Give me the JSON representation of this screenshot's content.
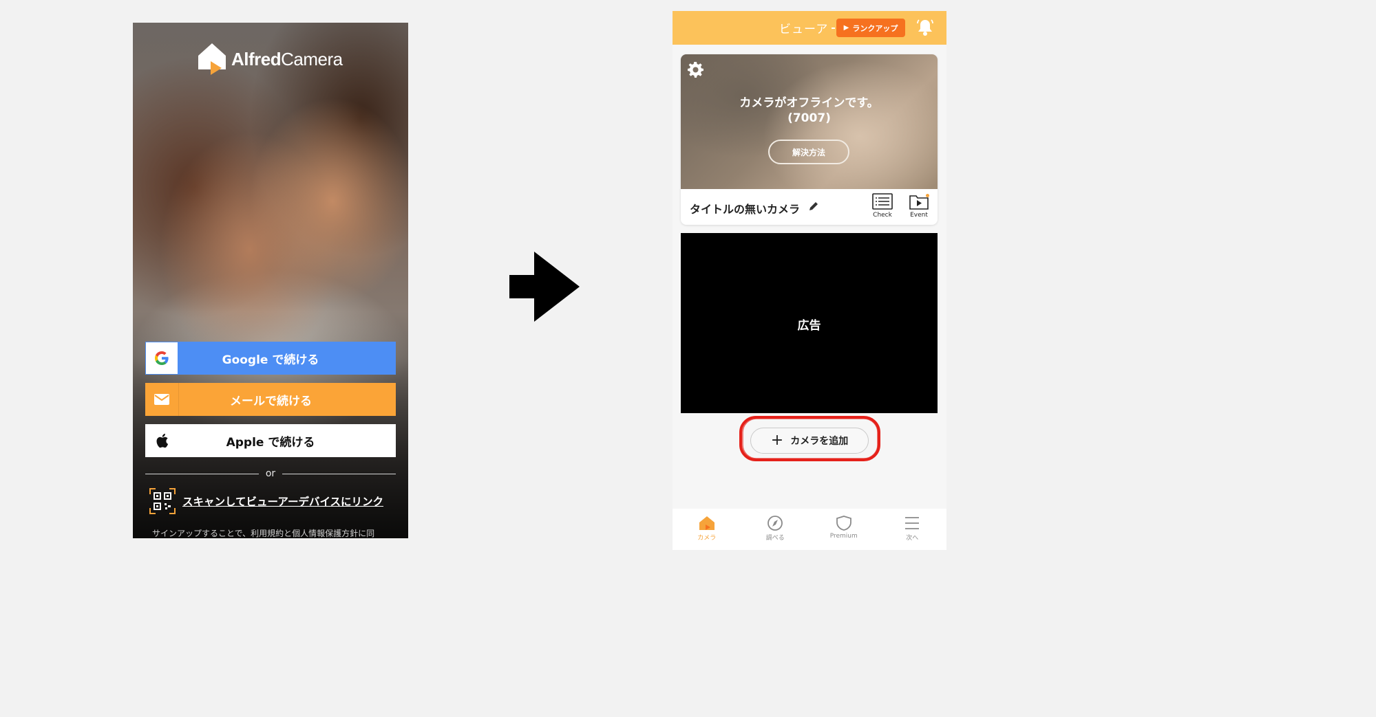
{
  "left_screen": {
    "logo": {
      "bold": "Alfred",
      "light": "Camera",
      "icon": "house-logo-icon"
    },
    "buttons": {
      "google": {
        "label": "Google で続ける",
        "icon": "google-icon"
      },
      "mail": {
        "label": "メールで続ける",
        "icon": "mail-icon"
      },
      "apple": {
        "label": "Apple で続ける",
        "icon": "apple-icon"
      }
    },
    "or_text": "or",
    "scan_link": "スキャンしてビューアーデバイスにリンク",
    "legal_text": "サインアップすることで、利用規約と個人情報保護方針に同"
  },
  "arrow": {
    "icon": "right-arrow-icon"
  },
  "right_screen": {
    "header": {
      "title": "ビューア",
      "rankup_label": "ランクアップ",
      "bell_icon": "bell-icon"
    },
    "camera_card": {
      "status_title": "カメラがオフラインです。",
      "status_code": "(7007)",
      "resolve_label": "解決方法",
      "camera_name": "タイトルの無いカメラ",
      "actions": [
        {
          "label": "Check",
          "icon": "check-list-icon"
        },
        {
          "label": "Event",
          "icon": "event-folder-icon"
        }
      ]
    },
    "ad_label": "広告",
    "add_camera_label": "カメラを追加",
    "tabs": [
      {
        "label": "カメラ",
        "icon": "home-icon",
        "active": true
      },
      {
        "label": "調べる",
        "icon": "compass-icon",
        "active": false
      },
      {
        "label": "Premium",
        "icon": "shield-icon",
        "active": false
      },
      {
        "label": "次へ",
        "icon": "menu-icon",
        "active": false
      }
    ],
    "colors": {
      "header": "#fcc25a",
      "rankup": "#f6711f",
      "accent": "#f6a33a",
      "highlight": "#e5211a"
    }
  }
}
